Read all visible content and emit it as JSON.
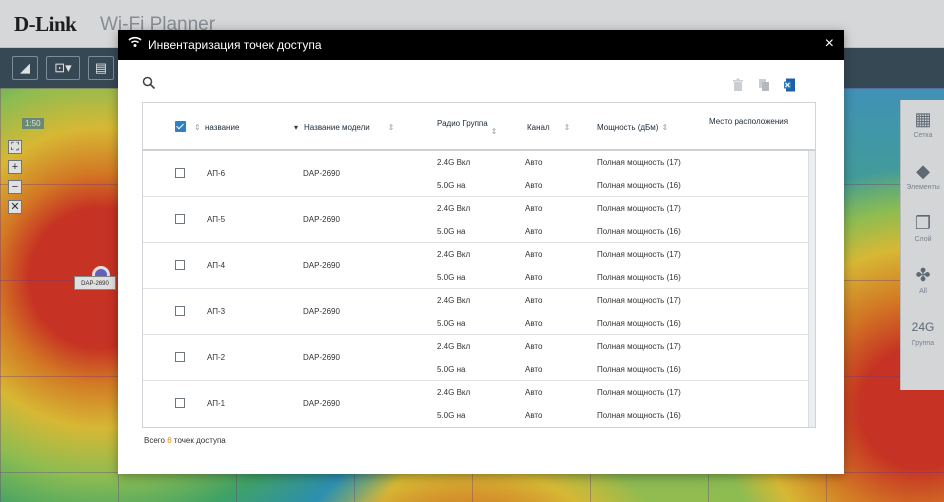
{
  "app": {
    "logo": "D-Link",
    "title": "Wi-Fi Planner"
  },
  "map": {
    "zoom_label": "1:50",
    "ap_label": "DAP-2690"
  },
  "right_panel": {
    "items": [
      {
        "icon": "grid-icon",
        "glyph": "▦",
        "label": "Сетка"
      },
      {
        "icon": "tag-icon",
        "glyph": "◆",
        "label": "Элементы"
      },
      {
        "icon": "layers-icon",
        "glyph": "❐",
        "label": "Слой"
      },
      {
        "icon": "all-icon",
        "glyph": "✤",
        "label": "All"
      },
      {
        "icon": "band-icon",
        "glyph": "24G",
        "label": "Группа"
      }
    ]
  },
  "dialog": {
    "title": "Инвентаризация точек доступа",
    "close": "×",
    "columns": [
      "название",
      "Название модели",
      "Радио Группа",
      "Канал",
      "Мощность (дБм)",
      "Место расположения"
    ],
    "rows": [
      {
        "name": "АП-6",
        "model": "DAP-2690",
        "band1": "2.4G Вкл",
        "band2": "5.0G на",
        "channel1": "Авто",
        "channel2": "Авто",
        "power1": "Полная мощность (17)",
        "power2": "Полная мощность (16)",
        "location": ""
      },
      {
        "name": "АП-5",
        "model": "DAP-2690",
        "band1": "2.4G Вкл",
        "band2": "5.0G на",
        "channel1": "Авто",
        "channel2": "Авто",
        "power1": "Полная мощность (17)",
        "power2": "Полная мощность (16)",
        "location": ""
      },
      {
        "name": "АП-4",
        "model": "DAP-2690",
        "band1": "2.4G Вкл",
        "band2": "5.0G на",
        "channel1": "Авто",
        "channel2": "Авто",
        "power1": "Полная мощность (17)",
        "power2": "Полная мощность (16)",
        "location": ""
      },
      {
        "name": "АП-3",
        "model": "DAP-2690",
        "band1": "2.4G Вкл",
        "band2": "5.0G на",
        "channel1": "Авто",
        "channel2": "Авто",
        "power1": "Полная мощность (17)",
        "power2": "Полная мощность (16)",
        "location": ""
      },
      {
        "name": "АП-2",
        "model": "DAP-2690",
        "band1": "2.4G Вкл",
        "band2": "5.0G на",
        "channel1": "Авто",
        "channel2": "Авто",
        "power1": "Полная мощность (17)",
        "power2": "Полная мощность (16)",
        "location": ""
      },
      {
        "name": "АП-1",
        "model": "DAP-2690",
        "band1": "2.4G Вкл",
        "band2": "5.0G на",
        "channel1": "Авто",
        "channel2": "Авто",
        "power1": "Полная мощность (17)",
        "power2": "Полная мощность (16)",
        "location": ""
      }
    ],
    "total_prefix": "Всего",
    "total_count": "6",
    "total_suffix": "точек доступа"
  },
  "colors": {
    "dialog_header": "#000000",
    "checkbox_accent": "#2f7fc2",
    "count_accent": "#e08a00",
    "toolbar": "#3f5261"
  }
}
